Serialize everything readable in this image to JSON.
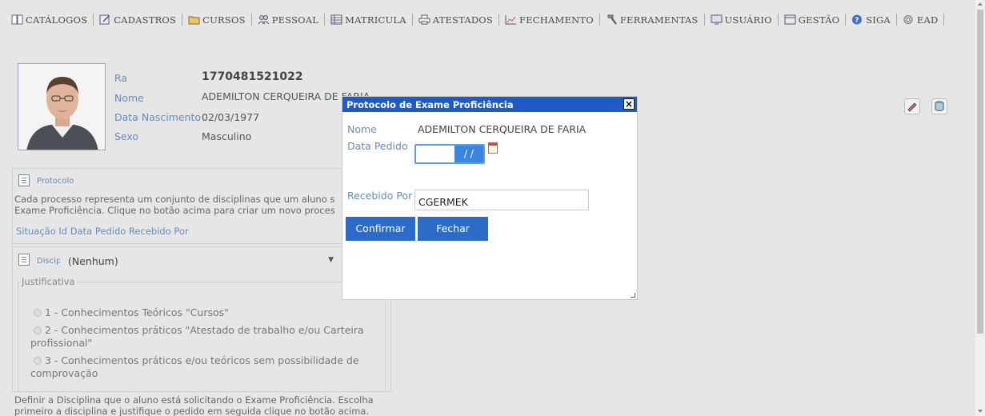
{
  "menu": [
    {
      "label": "CATÁLOGOS",
      "icon": "book-icon"
    },
    {
      "label": "CADASTROS",
      "icon": "edit-icon"
    },
    {
      "label": "CURSOS",
      "icon": "folder-icon"
    },
    {
      "label": "PESSOAL",
      "icon": "users-icon"
    },
    {
      "label": "MATRICULA",
      "icon": "table-icon"
    },
    {
      "label": "ATESTADOS",
      "icon": "print-icon"
    },
    {
      "label": "FECHAMENTO",
      "icon": "chart-icon"
    },
    {
      "label": "FERRAMENTAS",
      "icon": "hammer-icon"
    },
    {
      "label": "USUÁRIO",
      "icon": "monitor-icon"
    },
    {
      "label": "GESTÃO",
      "icon": "screen-icon"
    },
    {
      "label": "SIGA",
      "icon": "help-icon"
    },
    {
      "label": "EAD",
      "icon": "gear-icon"
    }
  ],
  "student": {
    "ra_label": "Ra",
    "ra": "1770481521022",
    "nome_label": "Nome",
    "nome": "ADEMILTON CERQUEIRA DE FARIA",
    "nasc_label": "Data Nascimento",
    "nasc": "02/03/1977",
    "sexo_label": "Sexo",
    "sexo": "Masculino"
  },
  "protocolo": {
    "title": "Protocolo",
    "desc1": "Cada processo representa um conjunto de disciplinas que um aluno s",
    "desc2": "Exame Proficiência. Clique no botão acima para criar um novo proces",
    "columns": "Situação Id Data Pedido Recebido Por"
  },
  "disciplina": {
    "label": "Disciplina",
    "selected": "(Nenhum)",
    "legend": "Justificativa",
    "opt1": "1 - Conhecimentos Teóricos \"Cursos\"",
    "opt2a": "2 - Conhecimentos práticos \"Atestado de trabalho e/ou Carteira",
    "opt2b": "profissional\"",
    "opt3a": "3 - Conhecimentos práticos e/ou teóricos sem possibilidade de",
    "opt3b": "comprovação",
    "help1": "Definir a Disciplina que o aluno está solicitando o Exame Proficiência. Escolha",
    "help2": "primeiro a disciplina e justifique o pedido em seguida clique no botão acima."
  },
  "modal": {
    "title": "Protocolo de Exame Proficiência",
    "close": "×",
    "nome_label": "Nome",
    "nome": "ADEMILTON CERQUEIRA DE FARIA",
    "data_label": "Data Pedido",
    "data_mask": "/ /",
    "recebido_label": "Recebido Por",
    "recebido_value": "CGERMEK",
    "confirm": "Confirmar",
    "close_btn": "Fechar"
  },
  "colors": {
    "accent": "#1e5bc6",
    "button": "#2c6cc8",
    "label": "#6b8bb5"
  }
}
